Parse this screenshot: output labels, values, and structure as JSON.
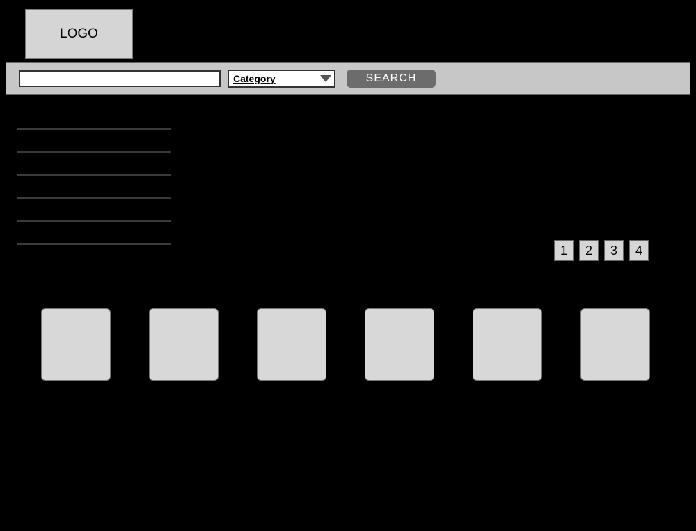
{
  "header": {
    "logo_text": "LOGO"
  },
  "search": {
    "input_value": "",
    "category_label": "Category",
    "button_label": "SEARCH"
  },
  "sidebar": {
    "links": [
      "",
      "",
      "",
      "",
      "",
      ""
    ]
  },
  "pagination": {
    "pages": [
      "1",
      "2",
      "3",
      "4"
    ]
  },
  "tiles": {
    "items": [
      "",
      "",
      "",
      "",
      "",
      ""
    ]
  }
}
